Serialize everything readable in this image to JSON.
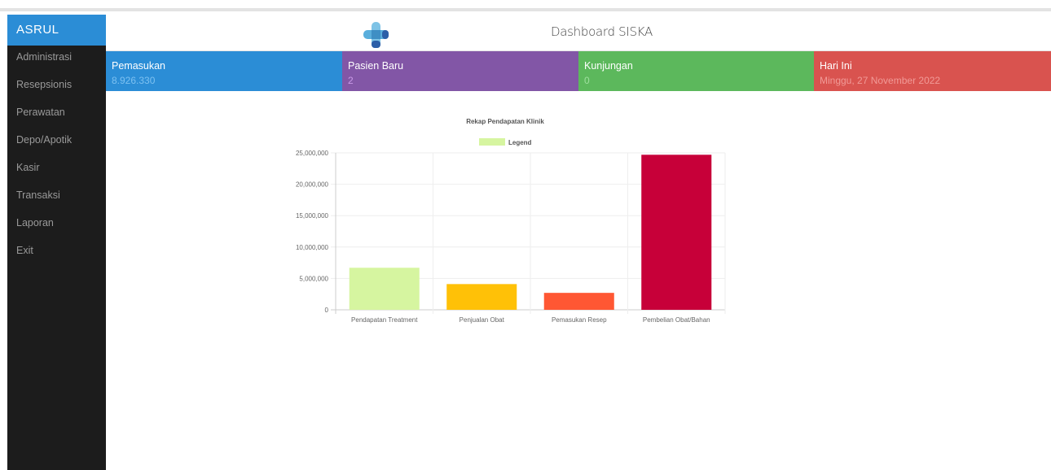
{
  "sidebar": {
    "brand": "ASRUL",
    "items": [
      {
        "label": "Administrasi"
      },
      {
        "label": "Resepsionis"
      },
      {
        "label": "Perawatan"
      },
      {
        "label": "Depo/Apotik"
      },
      {
        "label": "Kasir"
      },
      {
        "label": "Transaksi"
      },
      {
        "label": "Laporan"
      },
      {
        "label": "Exit"
      }
    ]
  },
  "header": {
    "title": "Dashboard SISKA",
    "logo_icon": "medical-cross-icon"
  },
  "stats": {
    "pemasukan": {
      "label": "Pemasukan",
      "value": "8.926.330",
      "color": "#2b8dd6"
    },
    "pasien_baru": {
      "label": "Pasien Baru",
      "value": "2",
      "color": "#8256a6"
    },
    "kunjungan": {
      "label": "Kunjungan",
      "value": "0",
      "color": "#5cb85c"
    },
    "hari_ini": {
      "label": "Hari Ini",
      "value": "Minggu, 27 November 2022",
      "color": "#d9534f"
    }
  },
  "chart_data": {
    "type": "bar",
    "title": "Rekap Pendapatan Klinik",
    "legend": "Legend",
    "legend_color": "#d6f5a0",
    "categories": [
      "Pendapatan Treatment",
      "Penjualan Obat",
      "Pemasukan Resep",
      "Pembelian Obat/Bahan"
    ],
    "values": [
      6700000,
      4100000,
      2700000,
      24700000
    ],
    "colors": [
      "#d6f5a0",
      "#ffc107",
      "#ff5733",
      "#c70039"
    ],
    "ylim": [
      0,
      25000000
    ],
    "yticks": [
      "0",
      "5,000,000",
      "10,000,000",
      "15,000,000",
      "20,000,000",
      "25,000,000"
    ],
    "grid": true,
    "legend_position": "top"
  }
}
